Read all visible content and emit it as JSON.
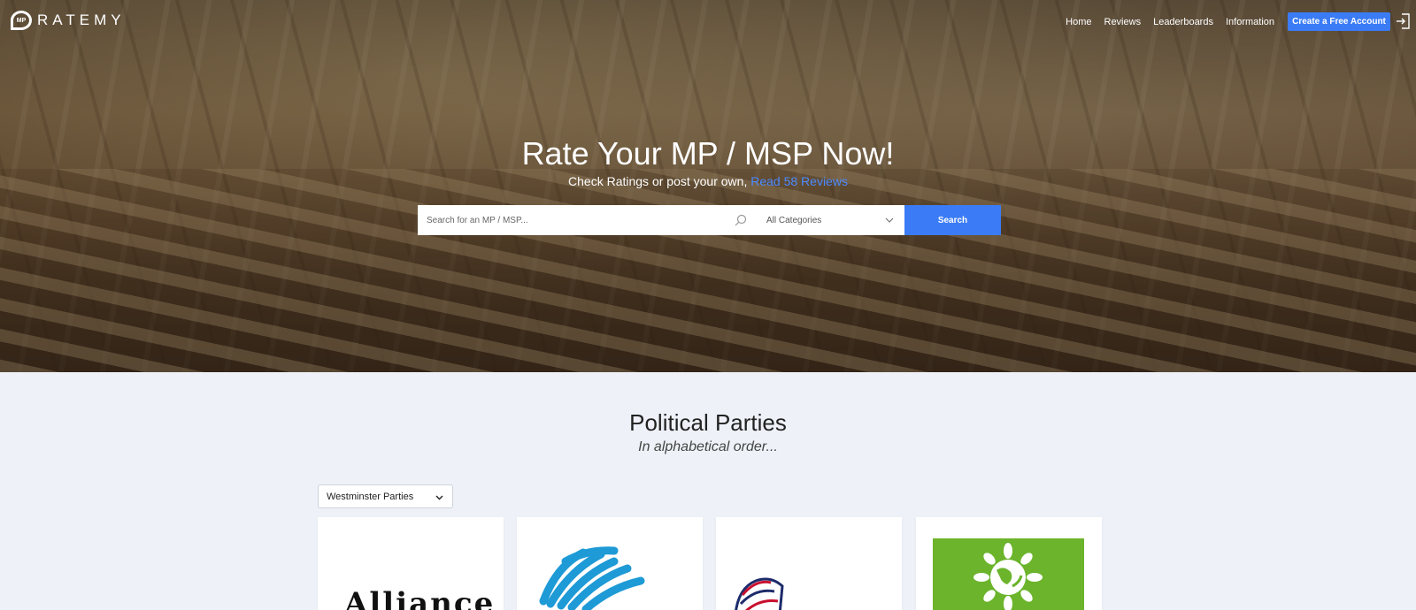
{
  "brand": {
    "logo_badge": "MP",
    "logo_text": "RATEMY"
  },
  "nav": {
    "links": [
      "Home",
      "Reviews",
      "Leaderboards",
      "Information"
    ],
    "cta": "Create a Free Account"
  },
  "hero": {
    "title": "Rate Your MP / MSP Now!",
    "subtitle_prefix": "Check Ratings or post your own, ",
    "subtitle_link": "Read 58 Reviews",
    "search_placeholder": "Search for an MP / MSP...",
    "category_selected": "All Categories",
    "search_button": "Search"
  },
  "section": {
    "title": "Political Parties",
    "subtitle": "In alphabetical order...",
    "filter_selected": "Westminster Parties"
  },
  "cards": [
    {
      "logo": "alliance-logo",
      "logo_text": "Alliance"
    },
    {
      "logo": "conservative-logo"
    },
    {
      "logo": "ukip-logo"
    },
    {
      "logo": "green-party-logo"
    }
  ],
  "colors": {
    "accent": "#3b7cf6",
    "link": "#4d8bff",
    "green": "#6bb42b",
    "background": "#eef2f8"
  }
}
